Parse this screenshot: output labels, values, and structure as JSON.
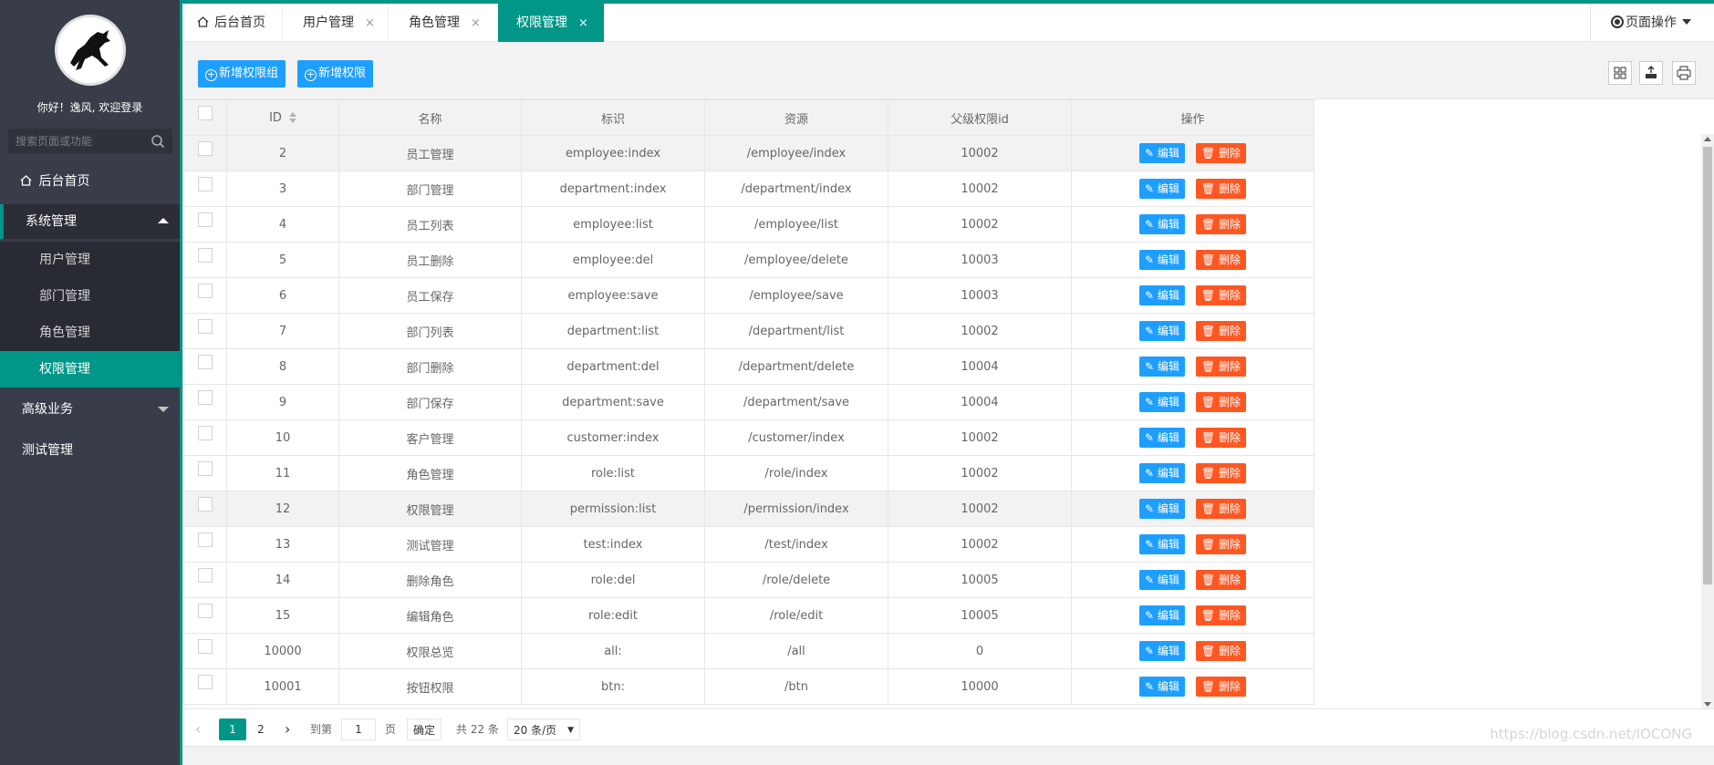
{
  "sidebar": {
    "welcome": "你好！逸风, 欢迎登录",
    "search_placeholder": "搜索页面或功能",
    "home_label": "后台首页",
    "system_label": "系统管理",
    "sub_items": [
      "用户管理",
      "部门管理",
      "角色管理",
      "权限管理"
    ],
    "active_sub": "权限管理",
    "advanced_label": "高级业务",
    "test_label": "测试管理"
  },
  "tabs": [
    {
      "label": "后台首页",
      "closable": false
    },
    {
      "label": "用户管理",
      "closable": true
    },
    {
      "label": "角色管理",
      "closable": true
    },
    {
      "label": "权限管理",
      "closable": true,
      "active": true
    }
  ],
  "tab_close_glyph": "×",
  "page_ops_label": "页面操作",
  "toolbar": {
    "add_group_label": "新增权限组",
    "add_permission_label": "新增权限"
  },
  "table": {
    "headers": [
      "ID",
      "名称",
      "标识",
      "资源",
      "父级权限id",
      "操作"
    ],
    "edit_label": "编辑",
    "delete_label": "删除",
    "rows": [
      [
        "2",
        "员工管理",
        "employee:index",
        "/employee/index",
        "10002"
      ],
      [
        "3",
        "部门管理",
        "department:index",
        "/department/index",
        "10002"
      ],
      [
        "4",
        "员工列表",
        "employee:list",
        "/employee/list",
        "10002"
      ],
      [
        "5",
        "员工删除",
        "employee:del",
        "/employee/delete",
        "10003"
      ],
      [
        "6",
        "员工保存",
        "employee:save",
        "/employee/save",
        "10003"
      ],
      [
        "7",
        "部门列表",
        "department:list",
        "/department/list",
        "10002"
      ],
      [
        "8",
        "部门删除",
        "department:del",
        "/department/delete",
        "10004"
      ],
      [
        "9",
        "部门保存",
        "department:save",
        "/department/save",
        "10004"
      ],
      [
        "10",
        "客户管理",
        "customer:index",
        "/customer/index",
        "10002"
      ],
      [
        "11",
        "角色管理",
        "role:list",
        "/role/index",
        "10002"
      ],
      [
        "12",
        "权限管理",
        "permission:list",
        "/permission/index",
        "10002"
      ],
      [
        "13",
        "测试管理",
        "test:index",
        "/test/index",
        "10002"
      ],
      [
        "14",
        "删除角色",
        "role:del",
        "/role/delete",
        "10005"
      ],
      [
        "15",
        "编辑角色",
        "role:edit",
        "/role/edit",
        "10005"
      ],
      [
        "10000",
        "权限总览",
        "all:",
        "/all",
        "0"
      ],
      [
        "10001",
        "按钮权限",
        "btn:",
        "/btn",
        "10000"
      ]
    ],
    "highlighted_rows": [
      0,
      10
    ]
  },
  "pager": {
    "current": "1",
    "next_page": "2",
    "goto_prefix": "到第",
    "goto_value": "1",
    "goto_suffix": "页",
    "confirm_label": "确定",
    "total_text": "共 22 条",
    "page_size": "20 条/页"
  },
  "watermark": "https://blog.csdn.net/IOCONG",
  "colors": {
    "accent": "#009688",
    "primary_button": "#1e9fff",
    "danger_button": "#ff5722",
    "sidebar_bg": "#393d49"
  }
}
